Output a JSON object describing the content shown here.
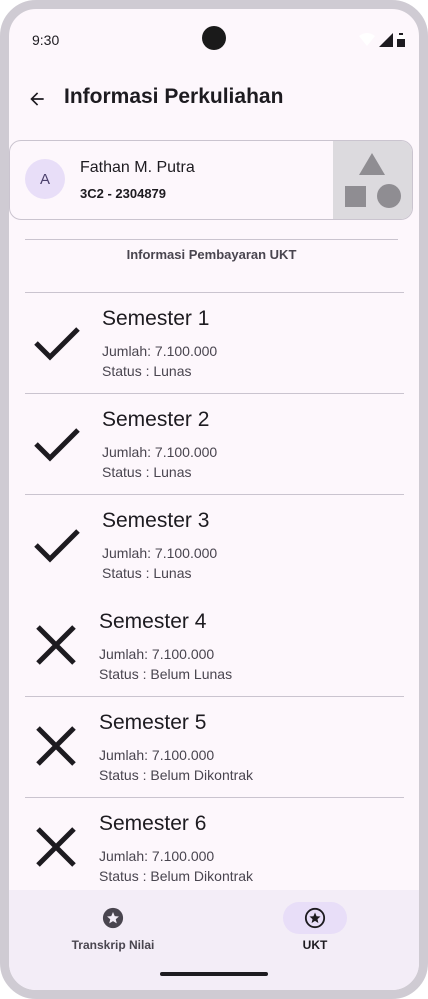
{
  "status_bar": {
    "time": "9:30"
  },
  "app_bar": {
    "title": "Informasi Perkuliahan"
  },
  "profile": {
    "avatar_letter": "A",
    "name": "Fathan M. Putra",
    "id": "3C2 - 2304879"
  },
  "section": {
    "title": "Informasi Pembayaran UKT"
  },
  "semesters": [
    {
      "title": "Semester 1",
      "amount": "Jumlah: 7.100.000",
      "status": "Status : Lunas",
      "paid": true
    },
    {
      "title": "Semester 2",
      "amount": "Jumlah: 7.100.000",
      "status": "Status : Lunas",
      "paid": true
    },
    {
      "title": "Semester 3",
      "amount": "Jumlah: 7.100.000",
      "status": "Status : Lunas",
      "paid": true
    },
    {
      "title": "Semester 4",
      "amount": "Jumlah: 7.100.000",
      "status": "Status : Belum Lunas",
      "paid": false
    },
    {
      "title": "Semester 5",
      "amount": "Jumlah: 7.100.000",
      "status": "Status : Belum Dikontrak",
      "paid": false
    },
    {
      "title": "Semester 6",
      "amount": "Jumlah: 7.100.000",
      "status": "Status : Belum Dikontrak",
      "paid": false
    }
  ],
  "bottom_nav": {
    "items": [
      {
        "label": "Transkrip Nilai",
        "icon": "star-circle-icon",
        "active": false
      },
      {
        "label": "UKT",
        "icon": "star-circle-icon",
        "active": true
      }
    ]
  },
  "colors": {
    "background": "#fdf7fc",
    "nav_bg": "#f3edf7",
    "active_pill": "#e8def8",
    "text": "#1d1b20"
  }
}
